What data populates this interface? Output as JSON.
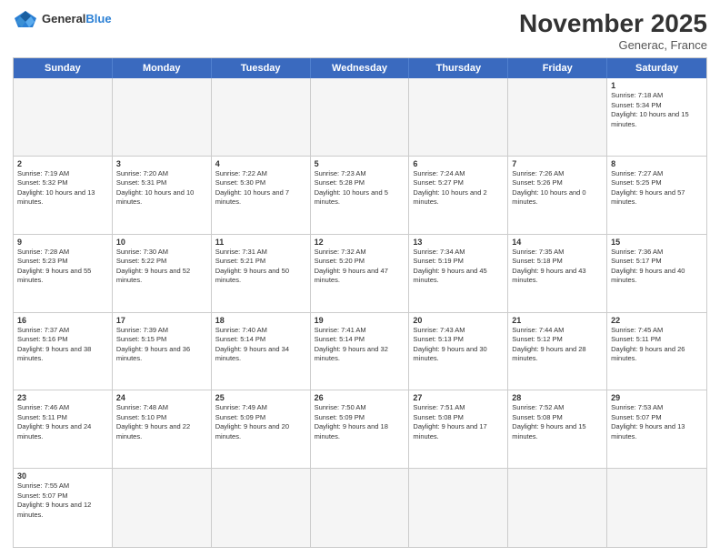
{
  "header": {
    "logo_general": "General",
    "logo_blue": "Blue",
    "month": "November 2025",
    "location": "Generac, France"
  },
  "days_of_week": [
    "Sunday",
    "Monday",
    "Tuesday",
    "Wednesday",
    "Thursday",
    "Friday",
    "Saturday"
  ],
  "weeks": [
    [
      {
        "day": "",
        "empty": true
      },
      {
        "day": "",
        "empty": true
      },
      {
        "day": "",
        "empty": true
      },
      {
        "day": "",
        "empty": true
      },
      {
        "day": "",
        "empty": true
      },
      {
        "day": "",
        "empty": true
      },
      {
        "day": "1",
        "sunrise": "Sunrise: 7:18 AM",
        "sunset": "Sunset: 5:34 PM",
        "daylight": "Daylight: 10 hours and 15 minutes."
      }
    ],
    [
      {
        "day": "2",
        "sunrise": "Sunrise: 7:19 AM",
        "sunset": "Sunset: 5:32 PM",
        "daylight": "Daylight: 10 hours and 13 minutes."
      },
      {
        "day": "3",
        "sunrise": "Sunrise: 7:20 AM",
        "sunset": "Sunset: 5:31 PM",
        "daylight": "Daylight: 10 hours and 10 minutes."
      },
      {
        "day": "4",
        "sunrise": "Sunrise: 7:22 AM",
        "sunset": "Sunset: 5:30 PM",
        "daylight": "Daylight: 10 hours and 7 minutes."
      },
      {
        "day": "5",
        "sunrise": "Sunrise: 7:23 AM",
        "sunset": "Sunset: 5:28 PM",
        "daylight": "Daylight: 10 hours and 5 minutes."
      },
      {
        "day": "6",
        "sunrise": "Sunrise: 7:24 AM",
        "sunset": "Sunset: 5:27 PM",
        "daylight": "Daylight: 10 hours and 2 minutes."
      },
      {
        "day": "7",
        "sunrise": "Sunrise: 7:26 AM",
        "sunset": "Sunset: 5:26 PM",
        "daylight": "Daylight: 10 hours and 0 minutes."
      },
      {
        "day": "8",
        "sunrise": "Sunrise: 7:27 AM",
        "sunset": "Sunset: 5:25 PM",
        "daylight": "Daylight: 9 hours and 57 minutes."
      }
    ],
    [
      {
        "day": "9",
        "sunrise": "Sunrise: 7:28 AM",
        "sunset": "Sunset: 5:23 PM",
        "daylight": "Daylight: 9 hours and 55 minutes."
      },
      {
        "day": "10",
        "sunrise": "Sunrise: 7:30 AM",
        "sunset": "Sunset: 5:22 PM",
        "daylight": "Daylight: 9 hours and 52 minutes."
      },
      {
        "day": "11",
        "sunrise": "Sunrise: 7:31 AM",
        "sunset": "Sunset: 5:21 PM",
        "daylight": "Daylight: 9 hours and 50 minutes."
      },
      {
        "day": "12",
        "sunrise": "Sunrise: 7:32 AM",
        "sunset": "Sunset: 5:20 PM",
        "daylight": "Daylight: 9 hours and 47 minutes."
      },
      {
        "day": "13",
        "sunrise": "Sunrise: 7:34 AM",
        "sunset": "Sunset: 5:19 PM",
        "daylight": "Daylight: 9 hours and 45 minutes."
      },
      {
        "day": "14",
        "sunrise": "Sunrise: 7:35 AM",
        "sunset": "Sunset: 5:18 PM",
        "daylight": "Daylight: 9 hours and 43 minutes."
      },
      {
        "day": "15",
        "sunrise": "Sunrise: 7:36 AM",
        "sunset": "Sunset: 5:17 PM",
        "daylight": "Daylight: 9 hours and 40 minutes."
      }
    ],
    [
      {
        "day": "16",
        "sunrise": "Sunrise: 7:37 AM",
        "sunset": "Sunset: 5:16 PM",
        "daylight": "Daylight: 9 hours and 38 minutes."
      },
      {
        "day": "17",
        "sunrise": "Sunrise: 7:39 AM",
        "sunset": "Sunset: 5:15 PM",
        "daylight": "Daylight: 9 hours and 36 minutes."
      },
      {
        "day": "18",
        "sunrise": "Sunrise: 7:40 AM",
        "sunset": "Sunset: 5:14 PM",
        "daylight": "Daylight: 9 hours and 34 minutes."
      },
      {
        "day": "19",
        "sunrise": "Sunrise: 7:41 AM",
        "sunset": "Sunset: 5:14 PM",
        "daylight": "Daylight: 9 hours and 32 minutes."
      },
      {
        "day": "20",
        "sunrise": "Sunrise: 7:43 AM",
        "sunset": "Sunset: 5:13 PM",
        "daylight": "Daylight: 9 hours and 30 minutes."
      },
      {
        "day": "21",
        "sunrise": "Sunrise: 7:44 AM",
        "sunset": "Sunset: 5:12 PM",
        "daylight": "Daylight: 9 hours and 28 minutes."
      },
      {
        "day": "22",
        "sunrise": "Sunrise: 7:45 AM",
        "sunset": "Sunset: 5:11 PM",
        "daylight": "Daylight: 9 hours and 26 minutes."
      }
    ],
    [
      {
        "day": "23",
        "sunrise": "Sunrise: 7:46 AM",
        "sunset": "Sunset: 5:11 PM",
        "daylight": "Daylight: 9 hours and 24 minutes."
      },
      {
        "day": "24",
        "sunrise": "Sunrise: 7:48 AM",
        "sunset": "Sunset: 5:10 PM",
        "daylight": "Daylight: 9 hours and 22 minutes."
      },
      {
        "day": "25",
        "sunrise": "Sunrise: 7:49 AM",
        "sunset": "Sunset: 5:09 PM",
        "daylight": "Daylight: 9 hours and 20 minutes."
      },
      {
        "day": "26",
        "sunrise": "Sunrise: 7:50 AM",
        "sunset": "Sunset: 5:09 PM",
        "daylight": "Daylight: 9 hours and 18 minutes."
      },
      {
        "day": "27",
        "sunrise": "Sunrise: 7:51 AM",
        "sunset": "Sunset: 5:08 PM",
        "daylight": "Daylight: 9 hours and 17 minutes."
      },
      {
        "day": "28",
        "sunrise": "Sunrise: 7:52 AM",
        "sunset": "Sunset: 5:08 PM",
        "daylight": "Daylight: 9 hours and 15 minutes."
      },
      {
        "day": "29",
        "sunrise": "Sunrise: 7:53 AM",
        "sunset": "Sunset: 5:07 PM",
        "daylight": "Daylight: 9 hours and 13 minutes."
      }
    ],
    [
      {
        "day": "30",
        "sunrise": "Sunrise: 7:55 AM",
        "sunset": "Sunset: 5:07 PM",
        "daylight": "Daylight: 9 hours and 12 minutes."
      },
      {
        "day": "",
        "empty": true
      },
      {
        "day": "",
        "empty": true
      },
      {
        "day": "",
        "empty": true
      },
      {
        "day": "",
        "empty": true
      },
      {
        "day": "",
        "empty": true
      },
      {
        "day": "",
        "empty": true
      }
    ]
  ]
}
